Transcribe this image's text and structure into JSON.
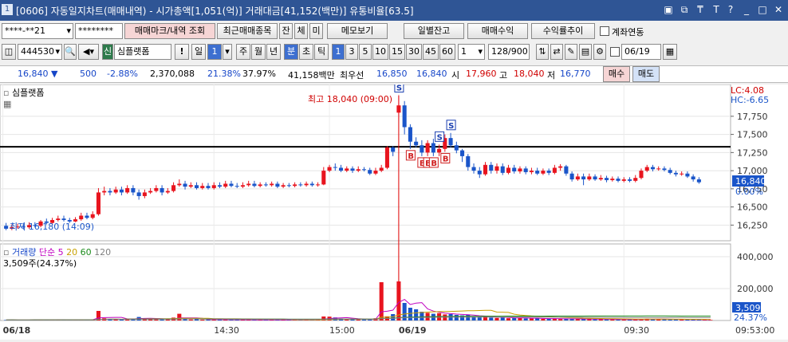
{
  "titlebar": {
    "num": "1",
    "title": "[0606] 자동일지차트(매매내역) - 시가총액[1,051(억)] 거래대금[41,152(백만)] 유통비율[63.5]",
    "icons": [
      "window-icon",
      "copy-icon",
      "pin-icon",
      "font-icon",
      "help-icon",
      "minimize-icon",
      "maximize-icon",
      "close-icon"
    ],
    "icon_glyphs": [
      "▣",
      "⧉",
      "₸",
      "T",
      "?",
      "_",
      "□",
      "✕"
    ]
  },
  "toolbar1": {
    "account": "****-**21",
    "password": "********",
    "btn_mark": "매매마크/내역 조회",
    "btn_recent": "최근매매종목",
    "btn_jan": "잔",
    "btn_che": "체",
    "btn_mi": "미",
    "btn_memo": "메모보기",
    "btn_daily": "일별잔고",
    "btn_profit": "매매수익",
    "btn_trend": "수익률추이",
    "account_link": "계좌연동"
  },
  "toolbar2": {
    "code": "444530",
    "market_badge": "신",
    "stock_name": "심플랫폼",
    "period_label": "일",
    "period_value": "1",
    "periods": [
      "주",
      "월",
      "년",
      "분",
      "초",
      "틱"
    ],
    "minutes": [
      "1",
      "3",
      "5",
      "10",
      "15",
      "30",
      "45",
      "60"
    ],
    "interval": "1",
    "count": "128",
    "count_total": "/900",
    "date": "06/19"
  },
  "quote": {
    "price": "16,840",
    "change": "500",
    "change_pct": "-2.88%",
    "volume": "2,370,088",
    "vol_pct": "21.38%",
    "turnover": "37.97%",
    "amount": "41,158백만",
    "best_ask_label": "최우선",
    "best_ask": "16,850",
    "best_bid": "16,840",
    "open_label": "시",
    "open": "17,960",
    "high_label": "고",
    "high": "18,040",
    "low_label": "저",
    "low": "16,770",
    "buy_label": "매수",
    "sell_label": "매도"
  },
  "price_panel": {
    "tab": "심플랫폼",
    "high_note": "최고 18,040 (09:00)",
    "low_note": "최저 16,180 (14:09)",
    "lc": "LC:4.08",
    "hc": "HC:-6.65",
    "current_price": "16,840",
    "current_pct": "0.00%",
    "y_ticks": [
      "17,750",
      "17,500",
      "17,250",
      "17,000",
      "16,750",
      "16,500",
      "16,250"
    ]
  },
  "volume_panel": {
    "label": "거래량",
    "ma_label": "단순",
    "ma_values": [
      "5",
      "20",
      "60",
      "120"
    ],
    "info": "3,509주(24.37%)",
    "current": "3,509",
    "current_pct": "24.37%",
    "y_ticks": [
      "400,000",
      "200,000"
    ]
  },
  "x_axis": {
    "labels": [
      "06/18",
      "14:30",
      "15:00",
      "06/19",
      "09:30"
    ],
    "current_time": "09:53:00"
  },
  "colors": {
    "up": "#e8141e",
    "down": "#1a55c9",
    "ma5": "#c000c0",
    "ma20": "#c8a000",
    "ma60": "#1a8a1a",
    "ma120": "#808080",
    "buy_marker": "#d02020",
    "sell_marker": "#1a3fb0"
  },
  "chart_data": {
    "type": "candlestick",
    "price_range": [
      16100,
      18100
    ],
    "volume_range": [
      0,
      450000
    ],
    "support_line": 17330,
    "candles": [
      [
        16240,
        16200,
        16280,
        16180
      ],
      [
        16200,
        16220,
        16260,
        16180
      ],
      [
        16220,
        16230,
        16270,
        16200
      ],
      [
        16230,
        16220,
        16280,
        16190
      ],
      [
        16220,
        16250,
        16290,
        16200
      ],
      [
        16250,
        16240,
        16290,
        16220
      ],
      [
        16240,
        16300,
        16320,
        16220
      ],
      [
        16300,
        16280,
        16340,
        16260
      ],
      [
        16280,
        16320,
        16350,
        16270
      ],
      [
        16320,
        16340,
        16380,
        16300
      ],
      [
        16340,
        16320,
        16380,
        16300
      ],
      [
        16320,
        16300,
        16350,
        16280
      ],
      [
        16300,
        16330,
        16360,
        16290
      ],
      [
        16330,
        16380,
        16420,
        16310
      ],
      [
        16380,
        16350,
        16420,
        16330
      ],
      [
        16350,
        16400,
        16440,
        16330
      ],
      [
        16400,
        16700,
        16760,
        16380
      ],
      [
        16700,
        16720,
        16780,
        16660
      ],
      [
        16720,
        16700,
        16760,
        16660
      ],
      [
        16700,
        16740,
        16780,
        16680
      ],
      [
        16740,
        16700,
        16780,
        16660
      ],
      [
        16700,
        16760,
        16800,
        16680
      ],
      [
        16760,
        16700,
        16800,
        16660
      ],
      [
        16700,
        16650,
        16740,
        16600
      ],
      [
        16650,
        16700,
        16740,
        16620
      ],
      [
        16700,
        16720,
        16760,
        16680
      ],
      [
        16720,
        16760,
        16800,
        16700
      ],
      [
        16760,
        16700,
        16800,
        16660
      ],
      [
        16700,
        16720,
        16760,
        16680
      ],
      [
        16720,
        16800,
        16840,
        16700
      ],
      [
        16800,
        16820,
        16880,
        16780
      ],
      [
        16820,
        16780,
        16860,
        16740
      ],
      [
        16780,
        16800,
        16840,
        16760
      ],
      [
        16800,
        16760,
        16840,
        16740
      ],
      [
        16760,
        16790,
        16830,
        16740
      ],
      [
        16790,
        16760,
        16830,
        16740
      ],
      [
        16760,
        16800,
        16840,
        16740
      ],
      [
        16800,
        16780,
        16840,
        16760
      ],
      [
        16780,
        16820,
        16860,
        16760
      ],
      [
        16820,
        16790,
        16860,
        16770
      ],
      [
        16790,
        16780,
        16830,
        16760
      ],
      [
        16780,
        16800,
        16840,
        16760
      ],
      [
        16800,
        16820,
        16860,
        16780
      ],
      [
        16820,
        16790,
        16860,
        16770
      ],
      [
        16790,
        16810,
        16840,
        16770
      ],
      [
        16810,
        16800,
        16840,
        16780
      ],
      [
        16800,
        16820,
        16850,
        16780
      ],
      [
        16820,
        16780,
        16850,
        16760
      ],
      [
        16780,
        16800,
        16830,
        16760
      ],
      [
        16800,
        16790,
        16830,
        16770
      ],
      [
        16790,
        16810,
        16840,
        16770
      ],
      [
        16810,
        16800,
        16840,
        16780
      ],
      [
        16800,
        16820,
        16850,
        16780
      ],
      [
        16820,
        16800,
        16850,
        16780
      ],
      [
        16800,
        16810,
        16840,
        16780
      ],
      [
        16810,
        17000,
        17050,
        16800
      ],
      [
        17000,
        17050,
        17080,
        16980
      ],
      [
        17050,
        17040,
        17100,
        17000
      ],
      [
        17040,
        17000,
        17080,
        16980
      ],
      [
        17000,
        17030,
        17060,
        16980
      ],
      [
        17030,
        17000,
        17060,
        16970
      ],
      [
        17000,
        17020,
        17060,
        16980
      ],
      [
        17020,
        17010,
        17050,
        16990
      ],
      [
        17010,
        16960,
        17040,
        16940
      ],
      [
        16960,
        17000,
        17040,
        16940
      ],
      [
        17000,
        17040,
        17080,
        16980
      ],
      [
        17040,
        17320,
        17340,
        17020
      ],
      [
        17320,
        17260,
        17340,
        17200
      ],
      [
        17800,
        17900,
        18040,
        17700
      ],
      [
        17900,
        17600,
        17960,
        17500
      ],
      [
        17600,
        17400,
        17640,
        17300
      ],
      [
        17400,
        17350,
        17460,
        17320
      ],
      [
        17350,
        17250,
        17420,
        17200
      ],
      [
        17250,
        17380,
        17420,
        17200
      ],
      [
        17380,
        17250,
        17440,
        17200
      ],
      [
        17250,
        17300,
        17360,
        17200
      ],
      [
        17300,
        17450,
        17500,
        17260
      ],
      [
        17450,
        17350,
        17520,
        17320
      ],
      [
        17350,
        17280,
        17400,
        17240
      ],
      [
        17280,
        17200,
        17300,
        17120
      ],
      [
        17200,
        17050,
        17230,
        17000
      ],
      [
        17050,
        17000,
        17100,
        16960
      ],
      [
        17000,
        16950,
        17050,
        16900
      ],
      [
        16950,
        17080,
        17120,
        16930
      ],
      [
        17080,
        17000,
        17120,
        16960
      ],
      [
        17000,
        17060,
        17100,
        16960
      ],
      [
        17060,
        16970,
        17100,
        16940
      ],
      [
        16970,
        17040,
        17080,
        16950
      ],
      [
        17040,
        16990,
        17080,
        16960
      ],
      [
        16990,
        17030,
        17060,
        16960
      ],
      [
        17030,
        16980,
        17060,
        16950
      ],
      [
        16980,
        17000,
        17040,
        16950
      ],
      [
        17000,
        16960,
        17040,
        16940
      ],
      [
        16960,
        17000,
        17030,
        16940
      ],
      [
        17000,
        16970,
        17030,
        16940
      ],
      [
        16970,
        17040,
        17080,
        16950
      ],
      [
        17040,
        17060,
        17090,
        17000
      ],
      [
        17060,
        16960,
        17080,
        16930
      ],
      [
        16960,
        16880,
        16990,
        16850
      ],
      [
        16880,
        16920,
        16960,
        16860
      ],
      [
        16920,
        16880,
        16960,
        16800
      ],
      [
        16880,
        16920,
        16960,
        16860
      ],
      [
        16920,
        16880,
        16950,
        16860
      ],
      [
        16880,
        16900,
        16940,
        16860
      ],
      [
        16900,
        16870,
        16930,
        16840
      ],
      [
        16870,
        16890,
        16920,
        16850
      ],
      [
        16890,
        16860,
        16920,
        16840
      ],
      [
        16860,
        16880,
        16910,
        16840
      ],
      [
        16880,
        16860,
        16910,
        16840
      ],
      [
        16860,
        16900,
        16940,
        16840
      ],
      [
        16900,
        17000,
        17030,
        16880
      ],
      [
        17000,
        17050,
        17080,
        16980
      ],
      [
        17050,
        17020,
        17080,
        16990
      ],
      [
        17020,
        17030,
        17060,
        17000
      ],
      [
        17030,
        17010,
        17060,
        16990
      ],
      [
        17010,
        16970,
        17040,
        16950
      ],
      [
        16970,
        16950,
        17000,
        16920
      ],
      [
        16950,
        16960,
        16990,
        16930
      ],
      [
        16960,
        16920,
        16990,
        16900
      ],
      [
        16920,
        16880,
        16950,
        16850
      ],
      [
        16880,
        16840,
        16910,
        16820
      ]
    ],
    "volumes": [
      3000,
      4000,
      2500,
      3500,
      3000,
      5000,
      4200,
      3800,
      4500,
      5200,
      3600,
      3100,
      2800,
      4700,
      5500,
      6000,
      60000,
      14000,
      9000,
      8000,
      7000,
      11000,
      12000,
      22000,
      13000,
      9000,
      7000,
      6500,
      8000,
      18000,
      42000,
      9000,
      6000,
      7500,
      5000,
      6000,
      5500,
      4800,
      7000,
      4500,
      5000,
      4200,
      5800,
      4000,
      4600,
      3800,
      4200,
      5000,
      3900,
      4100,
      3600,
      4400,
      4000,
      3700,
      3500,
      25000,
      24000,
      19000,
      12000,
      9000,
      8000,
      7500,
      6000,
      5000,
      14000,
      240000,
      26000,
      40000,
      245000,
      110000,
      80000,
      70000,
      55000,
      48000,
      42000,
      46000,
      38000,
      40000,
      35000,
      32000,
      36000,
      24000,
      20000,
      26000,
      18000,
      16000,
      20000,
      14000,
      18000,
      15000,
      13000,
      12000,
      14000,
      10000,
      11000,
      12000,
      9000,
      10000,
      9500,
      12000,
      8000,
      9000,
      7000,
      8500,
      6500,
      7000,
      6000,
      7200,
      5800,
      6400,
      9000,
      11000,
      8000,
      7000,
      7500,
      6500,
      7800,
      5800,
      6200,
      5200,
      4800,
      4000,
      3509
    ],
    "trade_markers": [
      {
        "type": "S",
        "index": 68
      },
      {
        "type": "B",
        "index": 70
      },
      {
        "type": "B",
        "index": 72
      },
      {
        "type": "B",
        "index": 73
      },
      {
        "type": "B",
        "index": 74
      },
      {
        "type": "S",
        "index": 75
      },
      {
        "type": "B",
        "index": 76
      },
      {
        "type": "S",
        "index": 77
      }
    ]
  }
}
